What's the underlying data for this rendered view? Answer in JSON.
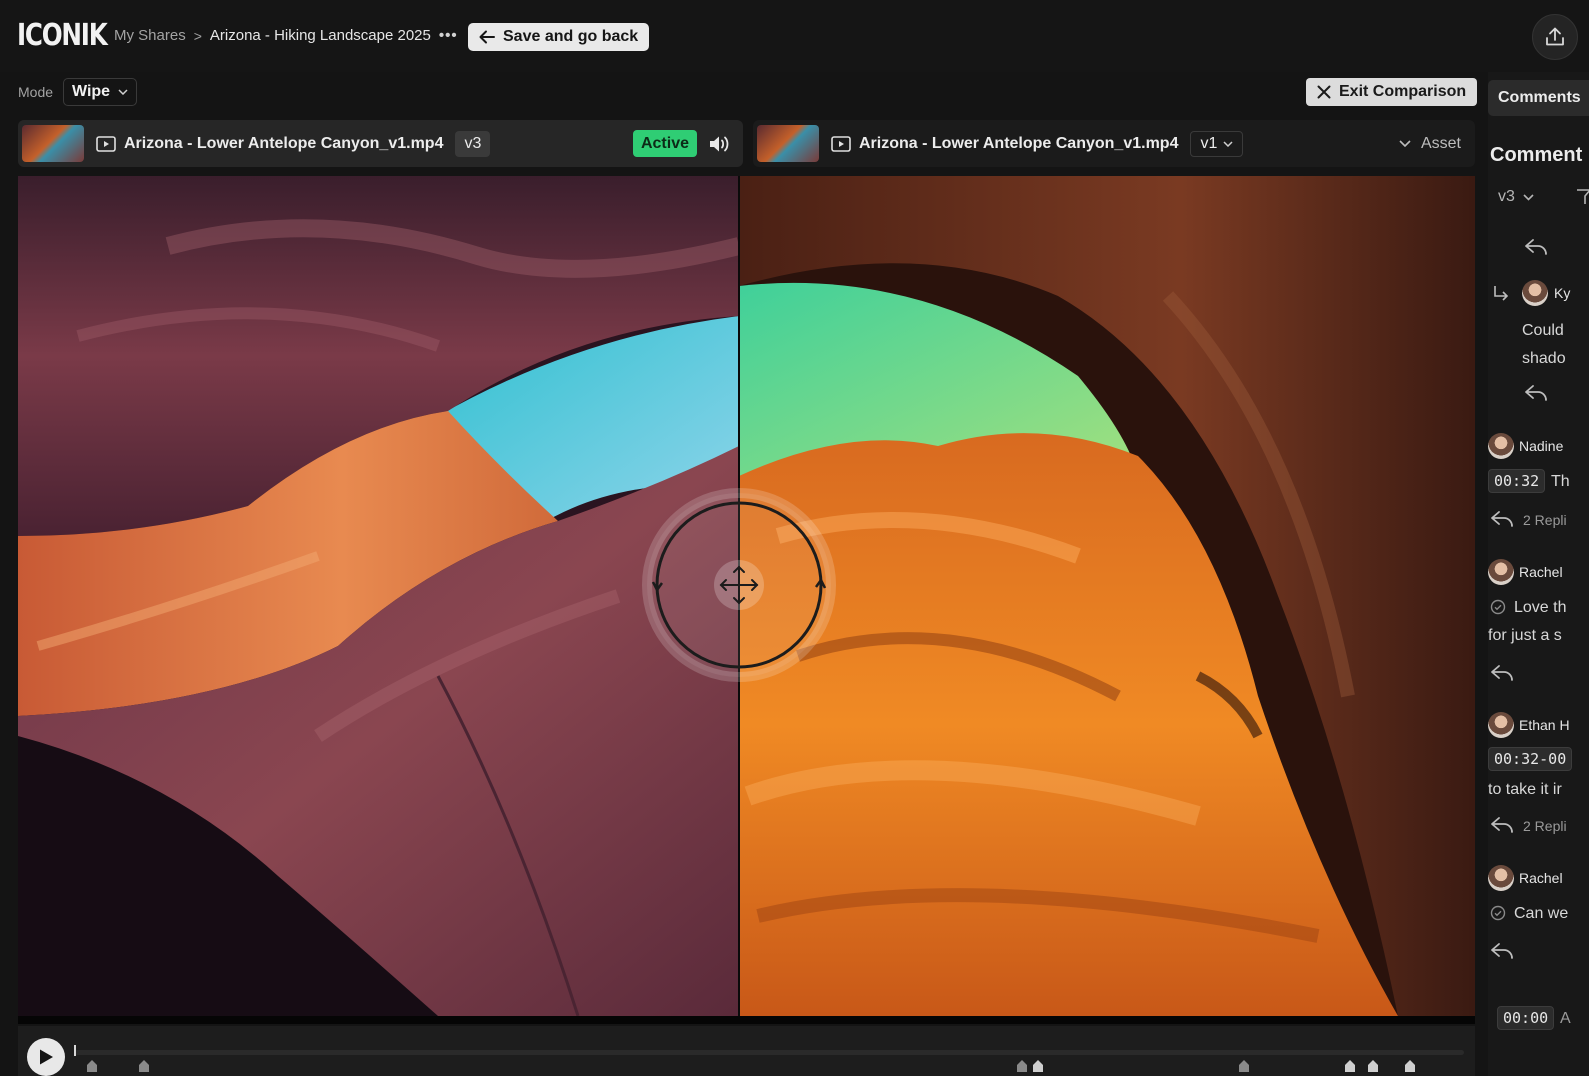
{
  "app": {
    "logo": "ICONIK"
  },
  "breadcrumb": {
    "root": "My Shares",
    "separator": ">",
    "current": "Arizona - Hiking Landscape 2025",
    "more": "•••"
  },
  "toolbar": {
    "save_label": "Save and go back"
  },
  "mode": {
    "label": "Mode",
    "value": "Wipe"
  },
  "comparison": {
    "exit_label": "Exit Comparison"
  },
  "left_asset": {
    "file_name": "Arizona - Lower Antelope Canyon_v1.mp4",
    "version": "v3",
    "status": "Active"
  },
  "right_asset": {
    "file_name": "Arizona - Lower Antelope Canyon_v1.mp4",
    "version": "v1",
    "toggle_label": "Asset"
  },
  "side_panel": {
    "tab_label": "Comments",
    "title": "Comment",
    "version": "v3",
    "comments": [
      {
        "author": "Ky",
        "text_line1": "Could",
        "text_line2": "shado"
      },
      {
        "author": "Nadine",
        "timecode": "00:32",
        "text": "Th",
        "replies": "2 Repli"
      },
      {
        "author": "Rachel",
        "text_line1": "Love th",
        "text_line2": "for just a s"
      },
      {
        "author": "Ethan H",
        "timecode": "00:32-00",
        "text": "to take it ir",
        "replies": "2 Repli"
      },
      {
        "author": "Rachel",
        "text_line1": "Can we"
      }
    ],
    "footer_timecode": "00:00",
    "footer_text": "A"
  },
  "colors": {
    "active_badge": "#2fcd74",
    "background": "#141414",
    "button_light": "#e9e9e9"
  },
  "icons": {
    "back": "arrow-left-icon",
    "upload": "upload-icon",
    "close": "close-icon",
    "play": "play-icon",
    "volume": "volume-icon",
    "reply": "reply-icon",
    "resolve": "check-circle-icon",
    "wipe_handle": "move-icon"
  }
}
